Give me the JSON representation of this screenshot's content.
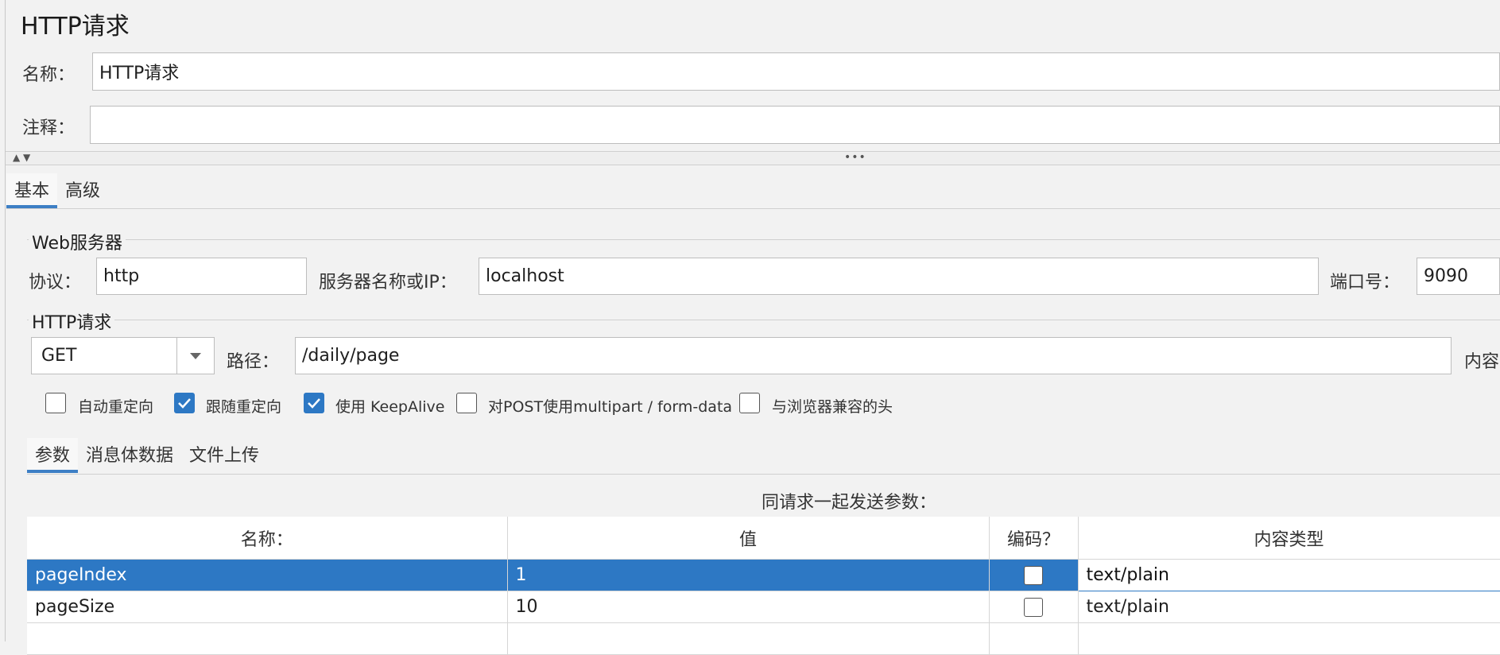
{
  "header": {
    "title": "HTTP请求"
  },
  "form": {
    "name_label": "名称：",
    "name_value": "HTTP请求",
    "comment_label": "注释：",
    "comment_value": ""
  },
  "splitter": {
    "arrows": "▲ ▼",
    "grip": "•••"
  },
  "tabs": [
    {
      "label": "基本",
      "active": true
    },
    {
      "label": "高级",
      "active": false
    }
  ],
  "web_server": {
    "section_title": "Web服务器",
    "protocol_label": "协议：",
    "protocol_value": "http",
    "server_label": "服务器名称或IP：",
    "server_value": "localhost",
    "port_label": "端口号：",
    "port_value": "9090"
  },
  "http_request": {
    "section_title": "HTTP请求",
    "method": "GET",
    "path_label": "路径：",
    "path_value": "/daily/page",
    "content_encoding_label": "内容"
  },
  "options": [
    {
      "label": "自动重定向",
      "checked": false
    },
    {
      "label": "跟随重定向",
      "checked": true
    },
    {
      "label": "使用 KeepAlive",
      "checked": true
    },
    {
      "label": "对POST使用multipart / form-data",
      "checked": false
    },
    {
      "label": "与浏览器兼容的头",
      "checked": false
    }
  ],
  "sub_tabs": [
    {
      "label": "参数",
      "active": true
    },
    {
      "label": "消息体数据",
      "active": false
    },
    {
      "label": "文件上传",
      "active": false
    }
  ],
  "params": {
    "caption": "同请求一起发送参数：",
    "columns": [
      "名称：",
      "值",
      "编码？",
      "内容类型"
    ],
    "rows": [
      {
        "name": "pageIndex",
        "value": "1",
        "encode": false,
        "content_type": "text/plain",
        "selected": true
      },
      {
        "name": "pageSize",
        "value": "10",
        "encode": false,
        "content_type": "text/plain",
        "selected": false
      }
    ]
  },
  "colors": {
    "accent": "#2d78c4",
    "background": "#f2f2f2"
  }
}
